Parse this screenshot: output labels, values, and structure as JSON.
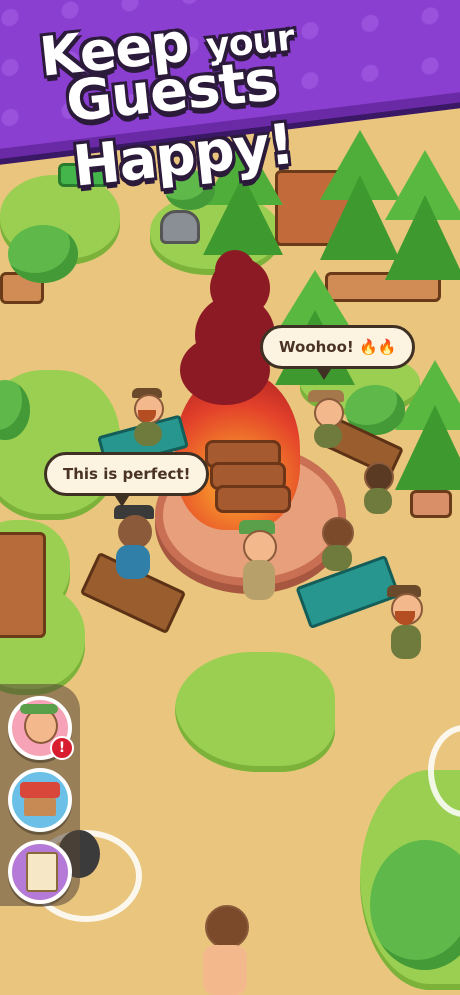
{
  "banner": {
    "line1_big": "Keep",
    "line1_small": "your",
    "line2": "Guests Happy!"
  },
  "bubbles": {
    "left": "This is perfect!",
    "right": "Woohoo! 🔥🔥"
  },
  "side_menu": {
    "items": [
      {
        "name": "guest-profile",
        "badge": "!"
      },
      {
        "name": "shop",
        "badge": ""
      },
      {
        "name": "quests",
        "badge": ""
      }
    ]
  },
  "colors": {
    "banner": "#8b3fd0",
    "ground": "#e9c57e",
    "grass": "#9bcf52",
    "fire": "#e3412a",
    "smoke": "#8c1a24"
  }
}
